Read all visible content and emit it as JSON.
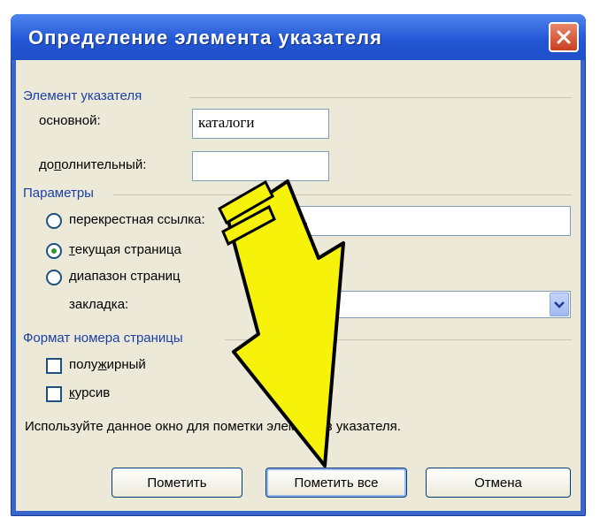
{
  "window": {
    "title": "Определение элемента указателя",
    "close_icon": "close-icon"
  },
  "index_entry": {
    "group_title": "Элемент указателя",
    "main_label": "основной:",
    "main_value": "каталоги",
    "sub_label": "дополнительный:",
    "sub_value": ""
  },
  "options": {
    "group_title": "Параметры",
    "cross_ref_label": "перекрестная ссылка:",
    "cross_ref_value": "См.",
    "current_page_label": "текущая страница",
    "page_range_label": "диапазон страниц",
    "bookmark_label": "закладка:",
    "bookmark_value": "",
    "selected": "current_page"
  },
  "page_format": {
    "group_title": "Формат номера страницы",
    "bold_label": "полужирный",
    "italic_label": "курсив",
    "bold_checked": false,
    "italic_checked": false
  },
  "info_text": "Используйте данное окно для пометки элементов указателя.",
  "buttons": {
    "mark": "Пометить",
    "mark_all": "Пометить все",
    "cancel": "Отмена"
  },
  "annotation": {
    "arrow_color": "#f6f20a",
    "arrow_outline": "#000000"
  }
}
